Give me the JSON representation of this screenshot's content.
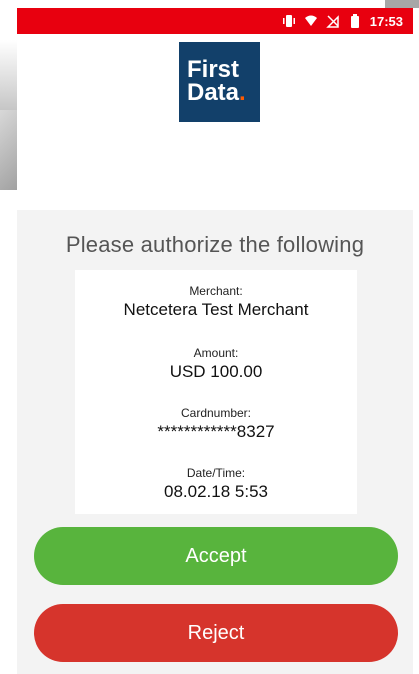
{
  "status_bar": {
    "time": "17:53",
    "icons": [
      "vibrate-icon",
      "wifi-icon",
      "no-sim-icon",
      "battery-icon"
    ],
    "color": "#e8000f"
  },
  "logo": {
    "line1": "First",
    "line2": "Data",
    "dot": ".",
    "bg": "#12406a"
  },
  "prompt": "Please authorize the following",
  "details": {
    "merchant_label": "Merchant:",
    "merchant_value": "Netcetera Test Merchant",
    "amount_label": "Amount:",
    "amount_value": "USD 100.00",
    "card_label": "Cardnumber:",
    "card_value": "************8327",
    "datetime_label": "Date/Time:",
    "datetime_value": "08.02.18 5:53"
  },
  "buttons": {
    "accept": "Accept",
    "reject": "Reject",
    "accept_color": "#58b43d",
    "reject_color": "#d6342c"
  }
}
